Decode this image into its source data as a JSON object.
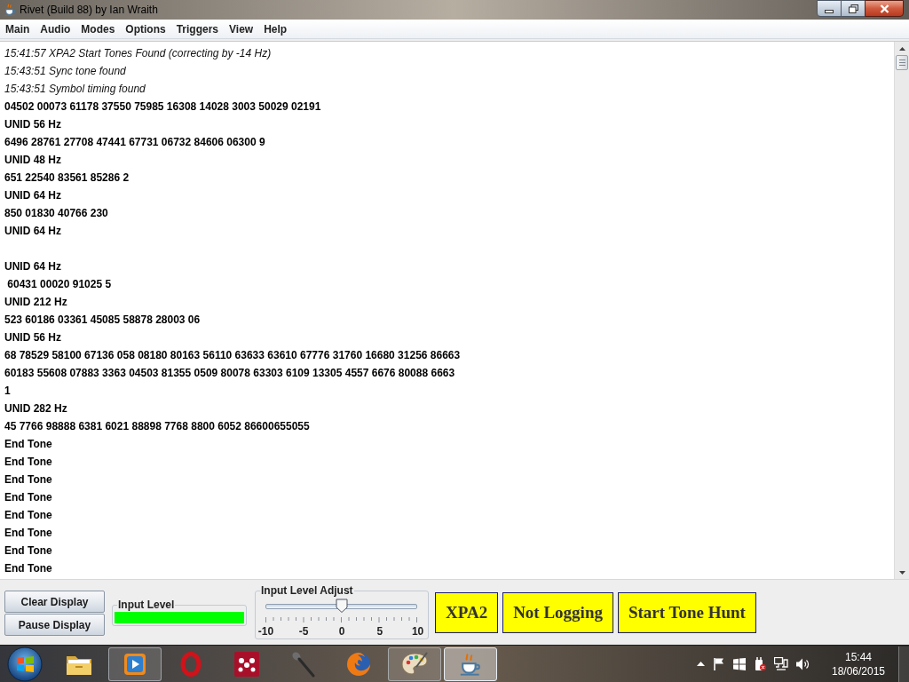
{
  "window": {
    "title": "Rivet (Build 88) by Ian Wraith"
  },
  "menu": [
    "Main",
    "Audio",
    "Modes",
    "Options",
    "Triggers",
    "View",
    "Help"
  ],
  "log": [
    {
      "kind": "status",
      "text": "15:41:57 XPA2 Start Tones Found (correcting by -14 Hz)"
    },
    {
      "kind": "status",
      "text": "15:43:51 Sync tone found"
    },
    {
      "kind": "status",
      "text": "15:43:51 Symbol timing found"
    },
    {
      "kind": "data",
      "text": "04502 00073 61178 37550 75985 16308 14028 3003 50029 02191"
    },
    {
      "kind": "data",
      "text": "UNID 56 Hz"
    },
    {
      "kind": "data",
      "text": "6496 28761 27708 47441 67731 06732 84606 06300 9"
    },
    {
      "kind": "data",
      "text": "UNID 48 Hz"
    },
    {
      "kind": "data",
      "text": "651 22540 83561 85286 2"
    },
    {
      "kind": "data",
      "text": "UNID 64 Hz"
    },
    {
      "kind": "data",
      "text": "850 01830 40766 230"
    },
    {
      "kind": "data",
      "text": "UNID 64 Hz"
    },
    {
      "kind": "blank"
    },
    {
      "kind": "data",
      "text": "UNID 64 Hz"
    },
    {
      "kind": "data",
      "text": " 60431 00020 91025 5"
    },
    {
      "kind": "data",
      "text": "UNID 212 Hz"
    },
    {
      "kind": "data",
      "text": "523 60186 03361 45085 58878 28003 06"
    },
    {
      "kind": "data",
      "text": "UNID 56 Hz"
    },
    {
      "kind": "data",
      "text": "68 78529 58100 67136 058 08180 80163 56110 63633 63610 67776 31760 16680 31256 86663"
    },
    {
      "kind": "data",
      "text": "60183 55608 07883 3363 04503 81355 0509 80078 63303 6109 13305 4557 6676 80088 6663"
    },
    {
      "kind": "data",
      "text": "1"
    },
    {
      "kind": "data",
      "text": "UNID 282 Hz"
    },
    {
      "kind": "data",
      "text": "45 7766 98888 6381 6021 88898 7768 8800 6052 86600655055"
    },
    {
      "kind": "data",
      "text": "End Tone"
    },
    {
      "kind": "data",
      "text": "End Tone"
    },
    {
      "kind": "data",
      "text": "End Tone"
    },
    {
      "kind": "data",
      "text": "End Tone"
    },
    {
      "kind": "data",
      "text": "End Tone"
    },
    {
      "kind": "data",
      "text": "End Tone"
    },
    {
      "kind": "data",
      "text": "End Tone"
    },
    {
      "kind": "data",
      "text": "End Tone"
    }
  ],
  "controls": {
    "display_buttons": [
      "Clear Display",
      "Pause Display"
    ],
    "input_level": {
      "label": "Input Level",
      "level": 1
    },
    "input_level_adjust": {
      "label": "Input Level Adjust",
      "level": 0.5,
      "scale_labels": [
        "-10",
        "-5",
        "0",
        "5",
        "10"
      ]
    },
    "status_buttons": [
      "XPA2",
      "Not Logging",
      "Start Tone Hunt"
    ]
  },
  "taskbar": {
    "apps": [
      {
        "running": false,
        "active": false
      },
      {
        "running": true,
        "active": false
      },
      {
        "running": false,
        "active": false
      },
      {
        "running": false,
        "active": false
      },
      {
        "running": false,
        "active": false
      },
      {
        "running": false,
        "active": false
      },
      {
        "running": true,
        "active": false
      },
      {
        "running": true,
        "active": true
      }
    ],
    "clock": {
      "time": "15:44",
      "date": "18/06/2015"
    }
  }
}
